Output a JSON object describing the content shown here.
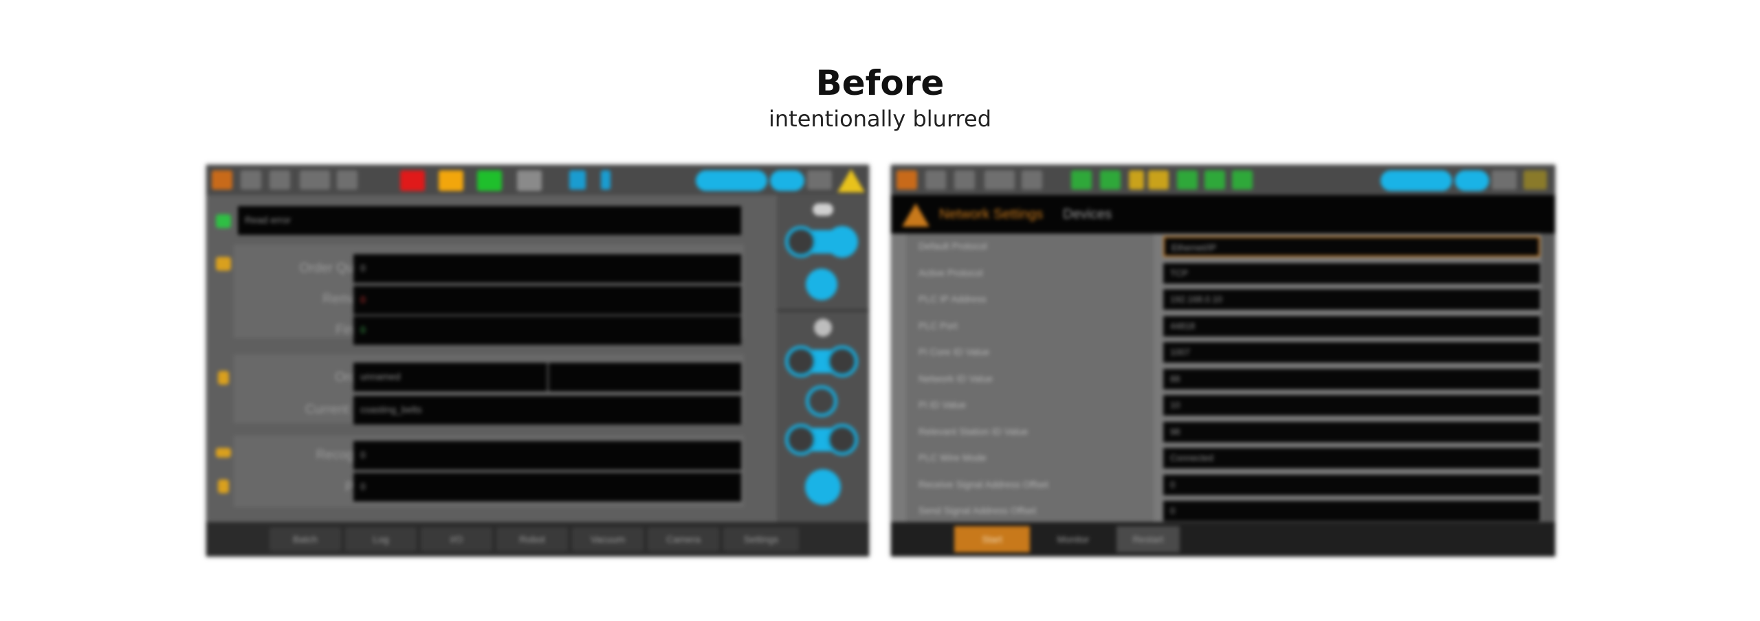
{
  "heading": "Before",
  "subheading": "intentionally blurred",
  "left_screen": {
    "fields": {
      "top_input": "Read error",
      "order_quantity_label": "Order Quantity",
      "order_quantity_value": "0",
      "remaining_label": "Remaining",
      "remaining_value": "0",
      "finished_label": "Finished",
      "finished_value": "0",
      "order_id_label": "Order ID",
      "order_id_value": "unnamed",
      "current_place_label": "Current Place",
      "current_place_value": "coasting_belts",
      "recognized_label": "Recognized",
      "recognized_value": "0",
      "placed_label": "Placed",
      "placed_value": "0"
    },
    "bottom_tabs": [
      "Batch",
      "Log",
      "I/O",
      "Robot",
      "Vacuum",
      "Camera",
      "Settings"
    ],
    "colors": {
      "stop": "#e01a1a",
      "pause": "#f2a60c",
      "start": "#1fbf2c",
      "accent": "#1ab3e6"
    }
  },
  "right_screen": {
    "header_title": "Network Settings",
    "header_tab": "Devices",
    "rows": [
      {
        "label": "Default Protocol",
        "value": "Ethernet/IP"
      },
      {
        "label": "Active Protocol",
        "value": "TCP"
      },
      {
        "label": "PLC IP Address",
        "value": "192.168.0.10"
      },
      {
        "label": "PLC Port",
        "value": "44818"
      },
      {
        "label": "Pi Core ID Value",
        "value": "1007"
      },
      {
        "label": "Network ID Value",
        "value": "88"
      },
      {
        "label": "Pi ID Value",
        "value": "10"
      },
      {
        "label": "Relevant Station ID Value",
        "value": "98"
      },
      {
        "label": "PLC Wire Mode",
        "value": "Connected"
      },
      {
        "label": "Receive Signal Address Offset",
        "value": "0"
      },
      {
        "label": "Send Signal Address Offset",
        "value": "0"
      }
    ],
    "bottom_tabs": [
      "Start",
      "Monitor",
      "Restart"
    ],
    "colors": {
      "header_accent": "#c8791b",
      "active_tab": "#c8791b"
    }
  }
}
